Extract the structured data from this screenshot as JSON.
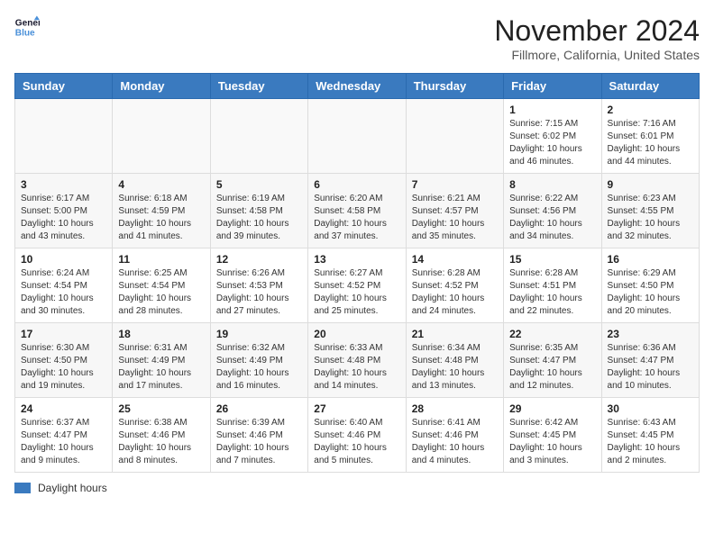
{
  "logo": {
    "line1": "General",
    "line2": "Blue"
  },
  "title": "November 2024",
  "subtitle": "Fillmore, California, United States",
  "days_of_week": [
    "Sunday",
    "Monday",
    "Tuesday",
    "Wednesday",
    "Thursday",
    "Friday",
    "Saturday"
  ],
  "weeks": [
    [
      {
        "day": "",
        "info": ""
      },
      {
        "day": "",
        "info": ""
      },
      {
        "day": "",
        "info": ""
      },
      {
        "day": "",
        "info": ""
      },
      {
        "day": "",
        "info": ""
      },
      {
        "day": "1",
        "info": "Sunrise: 7:15 AM\nSunset: 6:02 PM\nDaylight: 10 hours and 46 minutes."
      },
      {
        "day": "2",
        "info": "Sunrise: 7:16 AM\nSunset: 6:01 PM\nDaylight: 10 hours and 44 minutes."
      }
    ],
    [
      {
        "day": "3",
        "info": "Sunrise: 6:17 AM\nSunset: 5:00 PM\nDaylight: 10 hours and 43 minutes."
      },
      {
        "day": "4",
        "info": "Sunrise: 6:18 AM\nSunset: 4:59 PM\nDaylight: 10 hours and 41 minutes."
      },
      {
        "day": "5",
        "info": "Sunrise: 6:19 AM\nSunset: 4:58 PM\nDaylight: 10 hours and 39 minutes."
      },
      {
        "day": "6",
        "info": "Sunrise: 6:20 AM\nSunset: 4:58 PM\nDaylight: 10 hours and 37 minutes."
      },
      {
        "day": "7",
        "info": "Sunrise: 6:21 AM\nSunset: 4:57 PM\nDaylight: 10 hours and 35 minutes."
      },
      {
        "day": "8",
        "info": "Sunrise: 6:22 AM\nSunset: 4:56 PM\nDaylight: 10 hours and 34 minutes."
      },
      {
        "day": "9",
        "info": "Sunrise: 6:23 AM\nSunset: 4:55 PM\nDaylight: 10 hours and 32 minutes."
      }
    ],
    [
      {
        "day": "10",
        "info": "Sunrise: 6:24 AM\nSunset: 4:54 PM\nDaylight: 10 hours and 30 minutes."
      },
      {
        "day": "11",
        "info": "Sunrise: 6:25 AM\nSunset: 4:54 PM\nDaylight: 10 hours and 28 minutes."
      },
      {
        "day": "12",
        "info": "Sunrise: 6:26 AM\nSunset: 4:53 PM\nDaylight: 10 hours and 27 minutes."
      },
      {
        "day": "13",
        "info": "Sunrise: 6:27 AM\nSunset: 4:52 PM\nDaylight: 10 hours and 25 minutes."
      },
      {
        "day": "14",
        "info": "Sunrise: 6:28 AM\nSunset: 4:52 PM\nDaylight: 10 hours and 24 minutes."
      },
      {
        "day": "15",
        "info": "Sunrise: 6:28 AM\nSunset: 4:51 PM\nDaylight: 10 hours and 22 minutes."
      },
      {
        "day": "16",
        "info": "Sunrise: 6:29 AM\nSunset: 4:50 PM\nDaylight: 10 hours and 20 minutes."
      }
    ],
    [
      {
        "day": "17",
        "info": "Sunrise: 6:30 AM\nSunset: 4:50 PM\nDaylight: 10 hours and 19 minutes."
      },
      {
        "day": "18",
        "info": "Sunrise: 6:31 AM\nSunset: 4:49 PM\nDaylight: 10 hours and 17 minutes."
      },
      {
        "day": "19",
        "info": "Sunrise: 6:32 AM\nSunset: 4:49 PM\nDaylight: 10 hours and 16 minutes."
      },
      {
        "day": "20",
        "info": "Sunrise: 6:33 AM\nSunset: 4:48 PM\nDaylight: 10 hours and 14 minutes."
      },
      {
        "day": "21",
        "info": "Sunrise: 6:34 AM\nSunset: 4:48 PM\nDaylight: 10 hours and 13 minutes."
      },
      {
        "day": "22",
        "info": "Sunrise: 6:35 AM\nSunset: 4:47 PM\nDaylight: 10 hours and 12 minutes."
      },
      {
        "day": "23",
        "info": "Sunrise: 6:36 AM\nSunset: 4:47 PM\nDaylight: 10 hours and 10 minutes."
      }
    ],
    [
      {
        "day": "24",
        "info": "Sunrise: 6:37 AM\nSunset: 4:47 PM\nDaylight: 10 hours and 9 minutes."
      },
      {
        "day": "25",
        "info": "Sunrise: 6:38 AM\nSunset: 4:46 PM\nDaylight: 10 hours and 8 minutes."
      },
      {
        "day": "26",
        "info": "Sunrise: 6:39 AM\nSunset: 4:46 PM\nDaylight: 10 hours and 7 minutes."
      },
      {
        "day": "27",
        "info": "Sunrise: 6:40 AM\nSunset: 4:46 PM\nDaylight: 10 hours and 5 minutes."
      },
      {
        "day": "28",
        "info": "Sunrise: 6:41 AM\nSunset: 4:46 PM\nDaylight: 10 hours and 4 minutes."
      },
      {
        "day": "29",
        "info": "Sunrise: 6:42 AM\nSunset: 4:45 PM\nDaylight: 10 hours and 3 minutes."
      },
      {
        "day": "30",
        "info": "Sunrise: 6:43 AM\nSunset: 4:45 PM\nDaylight: 10 hours and 2 minutes."
      }
    ]
  ],
  "legend": {
    "label": "Daylight hours"
  }
}
